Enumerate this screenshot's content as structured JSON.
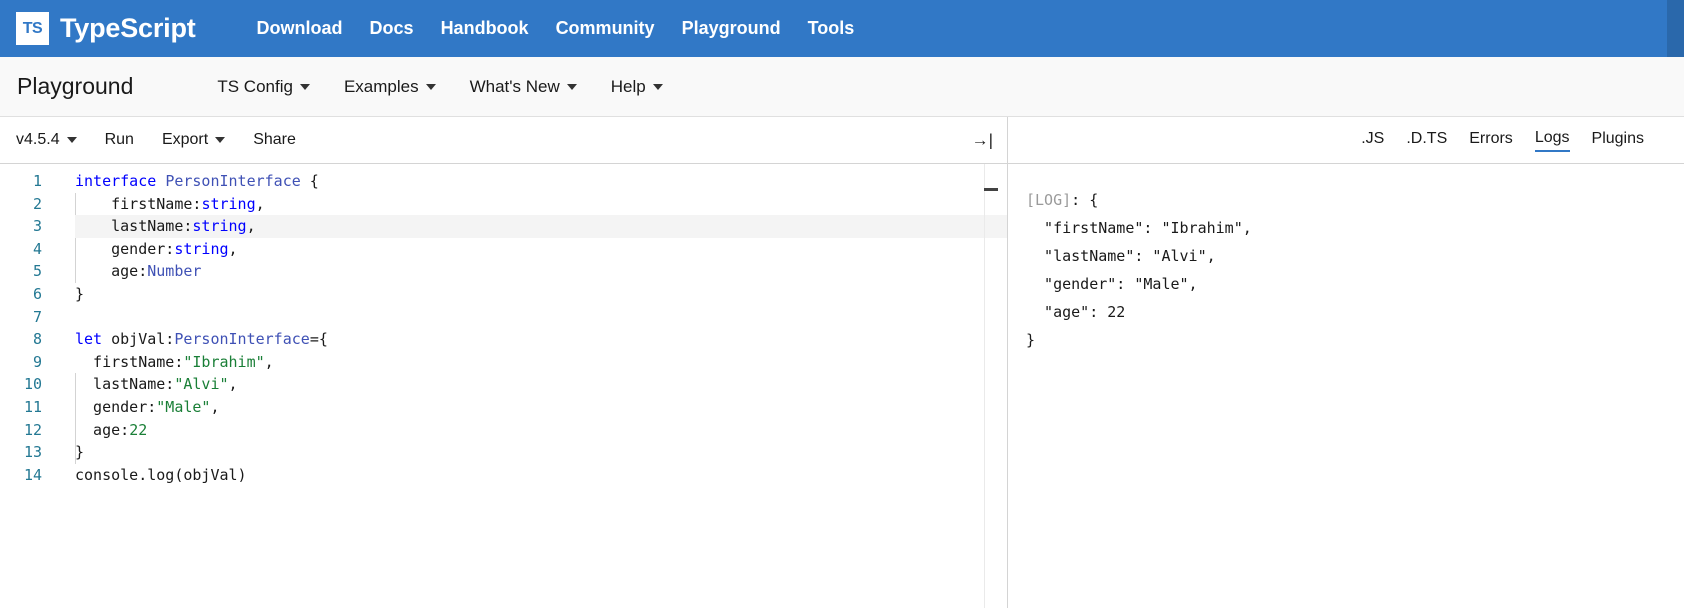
{
  "top_nav": {
    "logo_text": "TS",
    "logo_icon": "typescript-logo-icon",
    "brand": "TypeScript",
    "links": [
      {
        "label": "Download"
      },
      {
        "label": "Docs"
      },
      {
        "label": "Handbook"
      },
      {
        "label": "Community"
      },
      {
        "label": "Playground"
      },
      {
        "label": "Tools"
      }
    ],
    "background_color": "#3178c6"
  },
  "playground_nav": {
    "title": "Playground",
    "menus": [
      {
        "label": "TS Config",
        "has_caret": true
      },
      {
        "label": "Examples",
        "has_caret": true
      },
      {
        "label": "What's New",
        "has_caret": true
      },
      {
        "label": "Help",
        "has_caret": true
      }
    ]
  },
  "editor_toolbar": {
    "version": "v4.5.4",
    "version_has_caret": true,
    "run_label": "Run",
    "export_label": "Export",
    "export_has_caret": true,
    "share_label": "Share",
    "sidebar_toggle_icon": "collapse-right-icon",
    "sidebar_toggle_glyph": "→|"
  },
  "editor": {
    "active_line": 3,
    "line_numbers": [
      "1",
      "2",
      "3",
      "4",
      "5",
      "6",
      "7",
      "8",
      "9",
      "10",
      "11",
      "12",
      "13",
      "14"
    ],
    "lines": [
      {
        "n": 1,
        "tokens": [
          {
            "t": "interface ",
            "c": "kw"
          },
          {
            "t": "PersonInterface",
            "c": "cls"
          },
          {
            "t": " {",
            "c": "ident"
          }
        ]
      },
      {
        "n": 2,
        "tokens": [
          {
            "t": "    firstName:",
            "c": "ident"
          },
          {
            "t": "string",
            "c": "kw"
          },
          {
            "t": ",",
            "c": "ident"
          }
        ]
      },
      {
        "n": 3,
        "tokens": [
          {
            "t": "    lastName:",
            "c": "ident"
          },
          {
            "t": "string",
            "c": "kw"
          },
          {
            "t": ",",
            "c": "ident"
          }
        ]
      },
      {
        "n": 4,
        "tokens": [
          {
            "t": "    gender:",
            "c": "ident"
          },
          {
            "t": "string",
            "c": "kw"
          },
          {
            "t": ",",
            "c": "ident"
          }
        ]
      },
      {
        "n": 5,
        "tokens": [
          {
            "t": "    age:",
            "c": "ident"
          },
          {
            "t": "Number",
            "c": "cls"
          }
        ]
      },
      {
        "n": 6,
        "tokens": [
          {
            "t": "}",
            "c": "ident"
          }
        ]
      },
      {
        "n": 7,
        "tokens": [
          {
            "t": "",
            "c": "ident"
          }
        ]
      },
      {
        "n": 8,
        "tokens": [
          {
            "t": "let",
            "c": "kw"
          },
          {
            "t": " objVal:",
            "c": "ident"
          },
          {
            "t": "PersonInterface",
            "c": "cls"
          },
          {
            "t": "={",
            "c": "ident"
          }
        ]
      },
      {
        "n": 9,
        "tokens": [
          {
            "t": "  firstName:",
            "c": "ident"
          },
          {
            "t": "\"Ibrahim\"",
            "c": "str"
          },
          {
            "t": ",",
            "c": "ident"
          }
        ]
      },
      {
        "n": 10,
        "tokens": [
          {
            "t": "  lastName:",
            "c": "ident"
          },
          {
            "t": "\"Alvi\"",
            "c": "str"
          },
          {
            "t": ",",
            "c": "ident"
          }
        ]
      },
      {
        "n": 11,
        "tokens": [
          {
            "t": "  gender:",
            "c": "ident"
          },
          {
            "t": "\"Male\"",
            "c": "str"
          },
          {
            "t": ",",
            "c": "ident"
          }
        ]
      },
      {
        "n": 12,
        "tokens": [
          {
            "t": "  age:",
            "c": "ident"
          },
          {
            "t": "22",
            "c": "num"
          }
        ]
      },
      {
        "n": 13,
        "tokens": [
          {
            "t": "}",
            "c": "ident"
          }
        ]
      },
      {
        "n": 14,
        "tokens": [
          {
            "t": "console.log(objVal)",
            "c": "ident"
          }
        ]
      }
    ]
  },
  "right_panel": {
    "tabs": [
      {
        "label": ".JS",
        "active": false
      },
      {
        "label": ".D.TS",
        "active": false
      },
      {
        "label": "Errors",
        "active": false
      },
      {
        "label": "Logs",
        "active": true
      },
      {
        "label": "Plugins",
        "active": false
      }
    ],
    "active_tab": "Logs",
    "accent_color": "#3178c6",
    "logs": [
      {
        "tag": "[LOG]",
        "rest": ": {"
      },
      {
        "tag": "",
        "rest": "  \"firstName\": \"Ibrahim\","
      },
      {
        "tag": "",
        "rest": "  \"lastName\": \"Alvi\","
      },
      {
        "tag": "",
        "rest": "  \"gender\": \"Male\","
      },
      {
        "tag": "",
        "rest": "  \"age\": 22"
      },
      {
        "tag": "",
        "rest": "}"
      }
    ]
  }
}
